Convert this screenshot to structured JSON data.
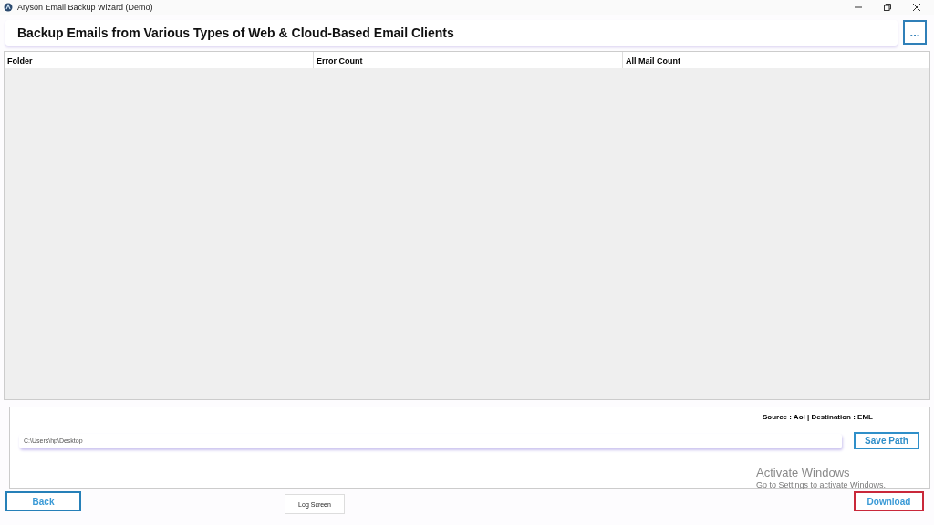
{
  "window": {
    "title": "Aryson Email Backup Wizard (Demo)"
  },
  "header": {
    "title": "Backup Emails from Various Types of Web & Cloud-Based Email Clients",
    "menu_button": "..."
  },
  "table": {
    "columns": [
      "Folder",
      "Error Count",
      "All Mail Count"
    ]
  },
  "output": {
    "summary": "Source : Aol | Destination : EML",
    "path": "C:\\Users\\hp\\Desktop",
    "save_button": "Save Path"
  },
  "buttons": [
    {
      "kind": "back",
      "label": "Back",
      "highlighted": false
    },
    {
      "kind": "log",
      "label": "Log Screen",
      "highlighted": false
    },
    {
      "kind": "download",
      "label": "Download",
      "highlighted": true
    }
  ],
  "activation_notice": {
    "title": "Activate Windows",
    "text": "Go to Settings to activate Windows."
  }
}
